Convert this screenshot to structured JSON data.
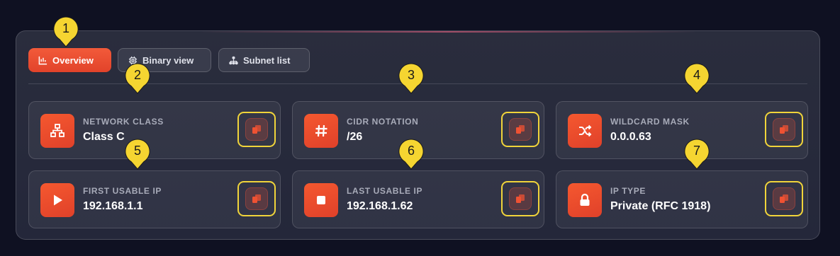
{
  "tabs": [
    {
      "label": "Overview",
      "icon": "chart-icon",
      "active": true
    },
    {
      "label": "Binary view",
      "icon": "chip-icon",
      "active": false
    },
    {
      "label": "Subnet list",
      "icon": "hierarchy-icon",
      "active": false
    }
  ],
  "cards": [
    {
      "label": "NETWORK CLASS",
      "value": "Class C",
      "icon": "network-icon"
    },
    {
      "label": "CIDR NOTATION",
      "value": "/26",
      "icon": "hash-icon"
    },
    {
      "label": "WILDCARD MASK",
      "value": "0.0.0.63",
      "icon": "shuffle-icon"
    },
    {
      "label": "FIRST USABLE IP",
      "value": "192.168.1.1",
      "icon": "play-icon"
    },
    {
      "label": "LAST USABLE IP",
      "value": "192.168.1.62",
      "icon": "stop-icon"
    },
    {
      "label": "IP TYPE",
      "value": "Private (RFC 1918)",
      "icon": "lock-icon"
    }
  ],
  "markers": [
    "1",
    "2",
    "3",
    "4",
    "5",
    "6",
    "7"
  ],
  "colors": {
    "accent": "#ef5233",
    "highlight": "#f0d43a",
    "background": "#0f1122",
    "panel": "#272a3c"
  }
}
